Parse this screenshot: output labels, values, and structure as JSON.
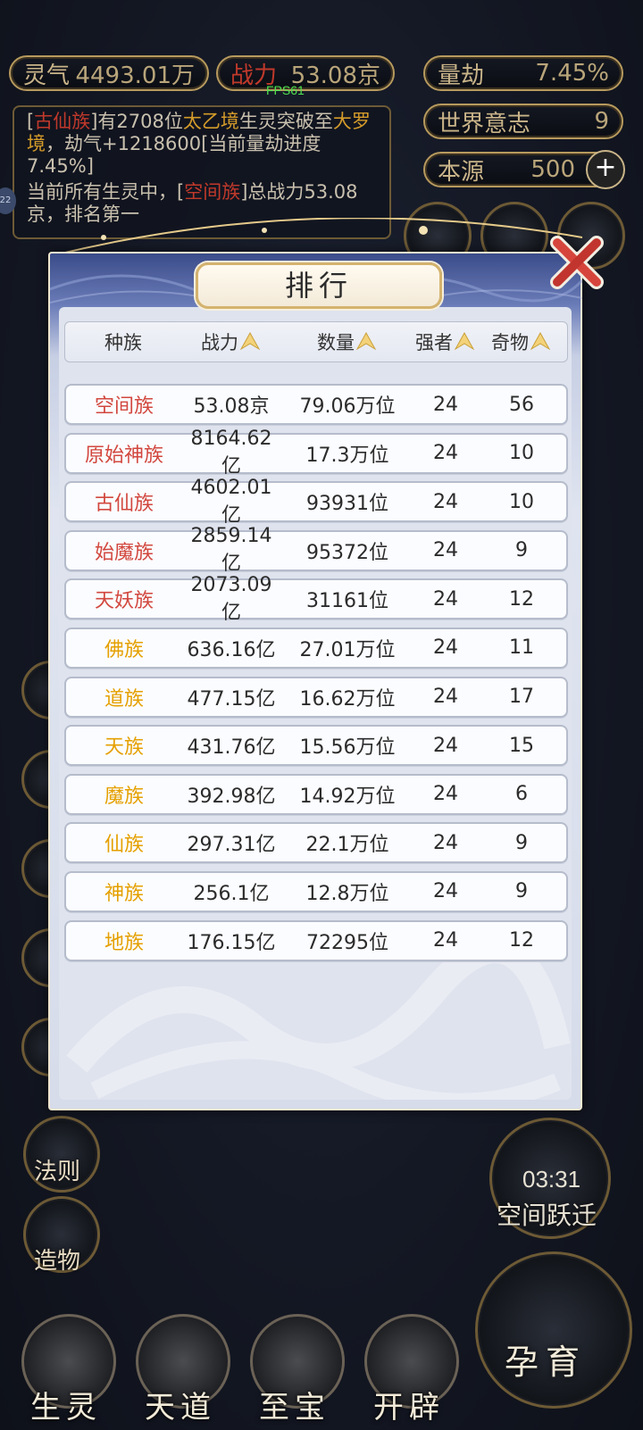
{
  "hud": {
    "lingqi_label": "灵气",
    "lingqi_value": "4493.01万",
    "zhanli_label": "战力",
    "zhanli_value": "53.08京",
    "liangjie_label": "量劫",
    "liangjie_value": "7.45%",
    "world_label": "世界意志",
    "world_value": "9",
    "benyuan_label": "本源",
    "benyuan_value": "500",
    "plus": "+",
    "fps": "FPS61"
  },
  "messages": {
    "m1_a": "[",
    "m1_race": "古仙族",
    "m1_b": "]有2708位",
    "m1_realm": "太乙境",
    "m1_c": "生灵突破至",
    "m1_realm2": "大罗境",
    "m1_d": "，劫气+1218600[当前量劫进度7.45%]",
    "m2_a": "当前所有生灵中，[",
    "m2_race": "空间族",
    "m2_b": "]总战力53.08京，排名第一",
    "bubble": "22"
  },
  "dialog": {
    "title": "排行",
    "headers": [
      "种族",
      "战力",
      "数量",
      "强者",
      "奇物"
    ],
    "rows": [
      {
        "race": "空间族",
        "power": "53.08京",
        "count": "79.06万位",
        "strong": "24",
        "items": "56",
        "color": "#d2473e"
      },
      {
        "race": "原始神族",
        "power": "8164.62亿",
        "count": "17.3万位",
        "strong": "24",
        "items": "10",
        "color": "#d2473e"
      },
      {
        "race": "古仙族",
        "power": "4602.01亿",
        "count": "93931位",
        "strong": "24",
        "items": "10",
        "color": "#d2473e"
      },
      {
        "race": "始魔族",
        "power": "2859.14亿",
        "count": "95372位",
        "strong": "24",
        "items": "9",
        "color": "#d2473e"
      },
      {
        "race": "天妖族",
        "power": "2073.09亿",
        "count": "31161位",
        "strong": "24",
        "items": "12",
        "color": "#d2473e"
      },
      {
        "race": "佛族",
        "power": "636.16亿",
        "count": "27.01万位",
        "strong": "24",
        "items": "11",
        "color": "#e5a000"
      },
      {
        "race": "道族",
        "power": "477.15亿",
        "count": "16.62万位",
        "strong": "24",
        "items": "17",
        "color": "#e5a000"
      },
      {
        "race": "天族",
        "power": "431.76亿",
        "count": "15.56万位",
        "strong": "24",
        "items": "15",
        "color": "#e5a000"
      },
      {
        "race": "魔族",
        "power": "392.98亿",
        "count": "14.92万位",
        "strong": "24",
        "items": "6",
        "color": "#e5a000"
      },
      {
        "race": "仙族",
        "power": "297.31亿",
        "count": "22.1万位",
        "strong": "24",
        "items": "9",
        "color": "#e5a000"
      },
      {
        "race": "神族",
        "power": "256.1亿",
        "count": "12.8万位",
        "strong": "24",
        "items": "9",
        "color": "#e5a000"
      },
      {
        "race": "地族",
        "power": "176.15亿",
        "count": "72295位",
        "strong": "24",
        "items": "12",
        "color": "#e5a000"
      }
    ]
  },
  "side": {
    "fa_ze": "法则",
    "zao_wu": "造物",
    "timer": "03:31",
    "jump": "空间跃迁",
    "incubate": "孕育"
  },
  "nav": {
    "sheng_ling": "生灵",
    "tian_dao": "天道",
    "zhi_bao": "至宝",
    "kai_pi": "开辟"
  }
}
